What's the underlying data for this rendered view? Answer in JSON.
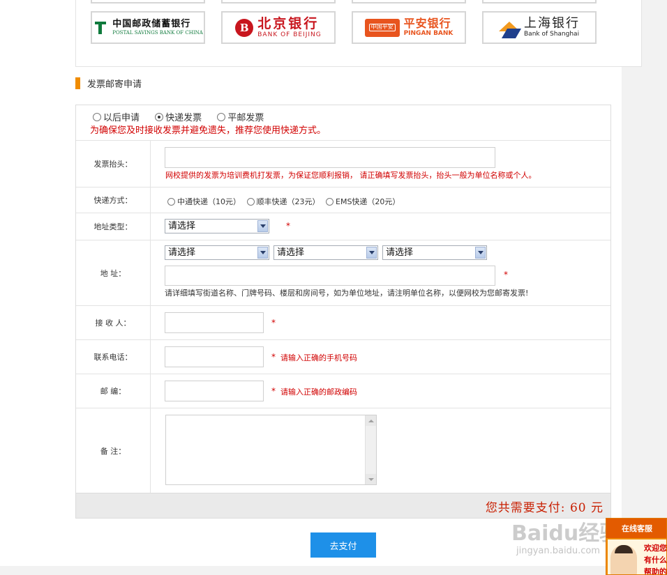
{
  "banks": [
    {
      "name_cn": "中国邮政储蓄银行",
      "name_en": "POSTAL SAVINGS BANK OF CHINA"
    },
    {
      "name_cn": "北京银行",
      "name_en": "BANK OF BEIJING"
    },
    {
      "name_cn": "平安银行",
      "name_en": "PINGAN BANK",
      "badge": "中国平安"
    },
    {
      "name_cn": "上海银行",
      "name_en": "Bank of Shanghai"
    }
  ],
  "section_title": "发票邮寄申请",
  "invoice_type": {
    "options": [
      "以后申请",
      "快递发票",
      "平邮发票"
    ],
    "selected": "快递发票",
    "note": "为确保您及时接收发票并避免遗失，推荐您使用快递方式。"
  },
  "fields": {
    "title_label": "发票抬头：",
    "title_value": "",
    "title_hint": "网校提供的发票为培训费机打发票，为保证您顺利报销， 请正确填写发票抬头，抬头一般为单位名称或个人。",
    "express_label": "快递方式：",
    "express_options": [
      "中通快递（10元）",
      "顺丰快递（23元）",
      "EMS快递（20元）"
    ],
    "address_type_label": "地址类型：",
    "address_type_value": "请选择",
    "address_label": "地  址：",
    "province_value": "请选择",
    "city_value": "请选择",
    "district_value": "请选择",
    "address_value": "",
    "address_hint": "请详细填写街道名称、门牌号码、楼层和房间号，如为单位地址，请注明单位名称，以便网校为您邮寄发票!",
    "receiver_label": "接 收 人：",
    "receiver_value": "",
    "phone_label": "联系电话：",
    "phone_value": "",
    "phone_hint": "请输入正确的手机号码",
    "zip_label": "邮  编：",
    "zip_value": "",
    "zip_hint": "请输入正确的邮政编码",
    "remark_label": "备  注：",
    "remark_value": "",
    "required_mark": "*"
  },
  "total": {
    "label": "您共需要支付:",
    "amount": "60",
    "unit": "元"
  },
  "pay_button": "去支付",
  "watermark": {
    "text": "Baidu经验",
    "sub": "jingyan.baidu.com"
  },
  "service_widget": {
    "title": "在线客服",
    "line1": "欢迎您",
    "line2": "有什么",
    "line3": "帮助的"
  }
}
